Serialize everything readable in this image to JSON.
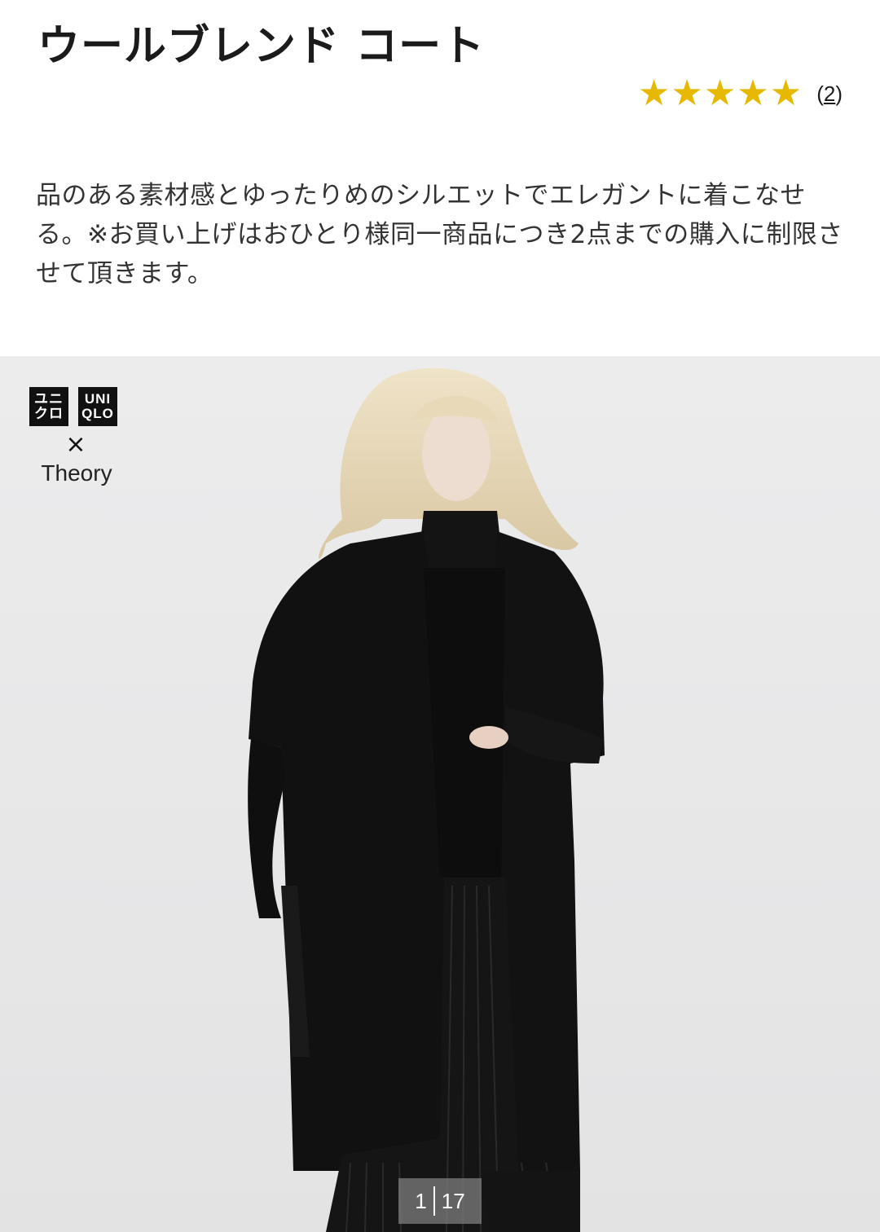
{
  "product": {
    "title": "ウールブレンド コート",
    "rating": {
      "stars": 5,
      "max_stars": 5,
      "review_count": "2",
      "open_paren": "(",
      "close_paren": ")"
    },
    "description": "品のある素材感とゆったりめのシルエットでエレガントに着こなせる。※お買い上げはおひとり様同一商品につき2点までの購入に制限させて頂きます。"
  },
  "gallery": {
    "logo": {
      "box1_line1": "ユニ",
      "box1_line2": "クロ",
      "box2_line1": "UNI",
      "box2_line2": "QLO",
      "times": "×",
      "collab": "Theory"
    },
    "pager": {
      "current": "1",
      "total": "17"
    }
  },
  "colors": {
    "star": "#e6b800",
    "background": "#e9e9ea",
    "title": "#1b1b1b"
  },
  "icons": {
    "star": "star-icon"
  }
}
